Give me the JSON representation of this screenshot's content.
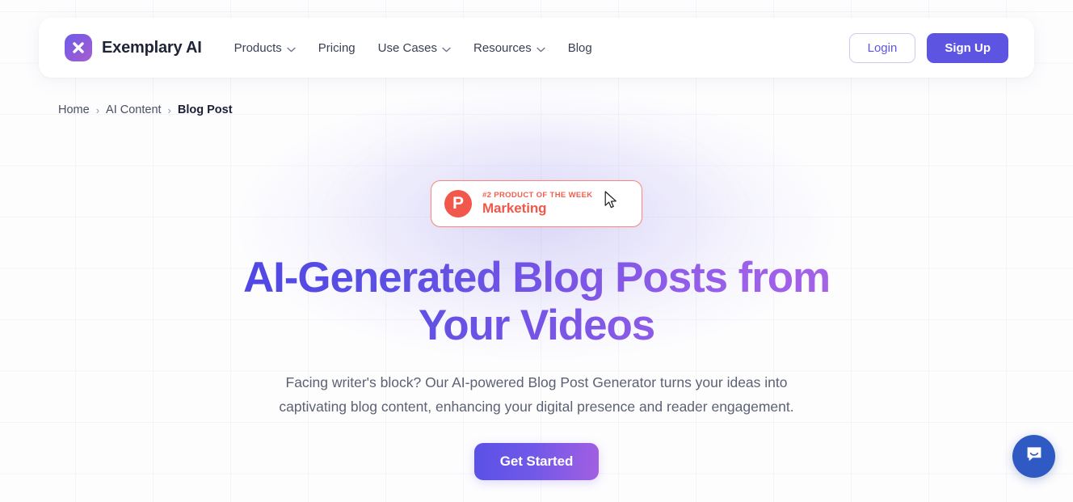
{
  "header": {
    "brand_name": "Exemplary AI",
    "logo_icon": "x-mark-logo-icon",
    "nav": [
      {
        "label": "Products",
        "has_chevron": true
      },
      {
        "label": "Pricing",
        "has_chevron": false
      },
      {
        "label": "Use Cases",
        "has_chevron": true
      },
      {
        "label": "Resources",
        "has_chevron": true
      },
      {
        "label": "Blog",
        "has_chevron": false
      }
    ],
    "login_label": "Login",
    "signup_label": "Sign Up"
  },
  "breadcrumb": {
    "items": [
      "Home",
      "AI Content",
      "Blog Post"
    ],
    "separator": "›"
  },
  "hero": {
    "badge": {
      "avatar_letter": "P",
      "kicker": "#2 PRODUCT OF THE WEEK",
      "title": "Marketing"
    },
    "headline": "AI-Generated Blog Posts from Your Videos",
    "subheading": "Facing writer's block? Our AI-powered Blog Post Generator turns your ideas into captivating blog content, enhancing your digital presence and reader engagement.",
    "cta_label": "Get Started"
  },
  "widgets": {
    "chat_launcher_icon": "chat-bubble-icon"
  },
  "colors": {
    "brand_indigo": "#5d55e2",
    "headline_gradient_start": "#4f46e5",
    "headline_gradient_end": "#a763e8",
    "badge_coral": "#f1574a",
    "chat_blue": "#2f5ac3",
    "page_background": "#fdfdfe"
  }
}
